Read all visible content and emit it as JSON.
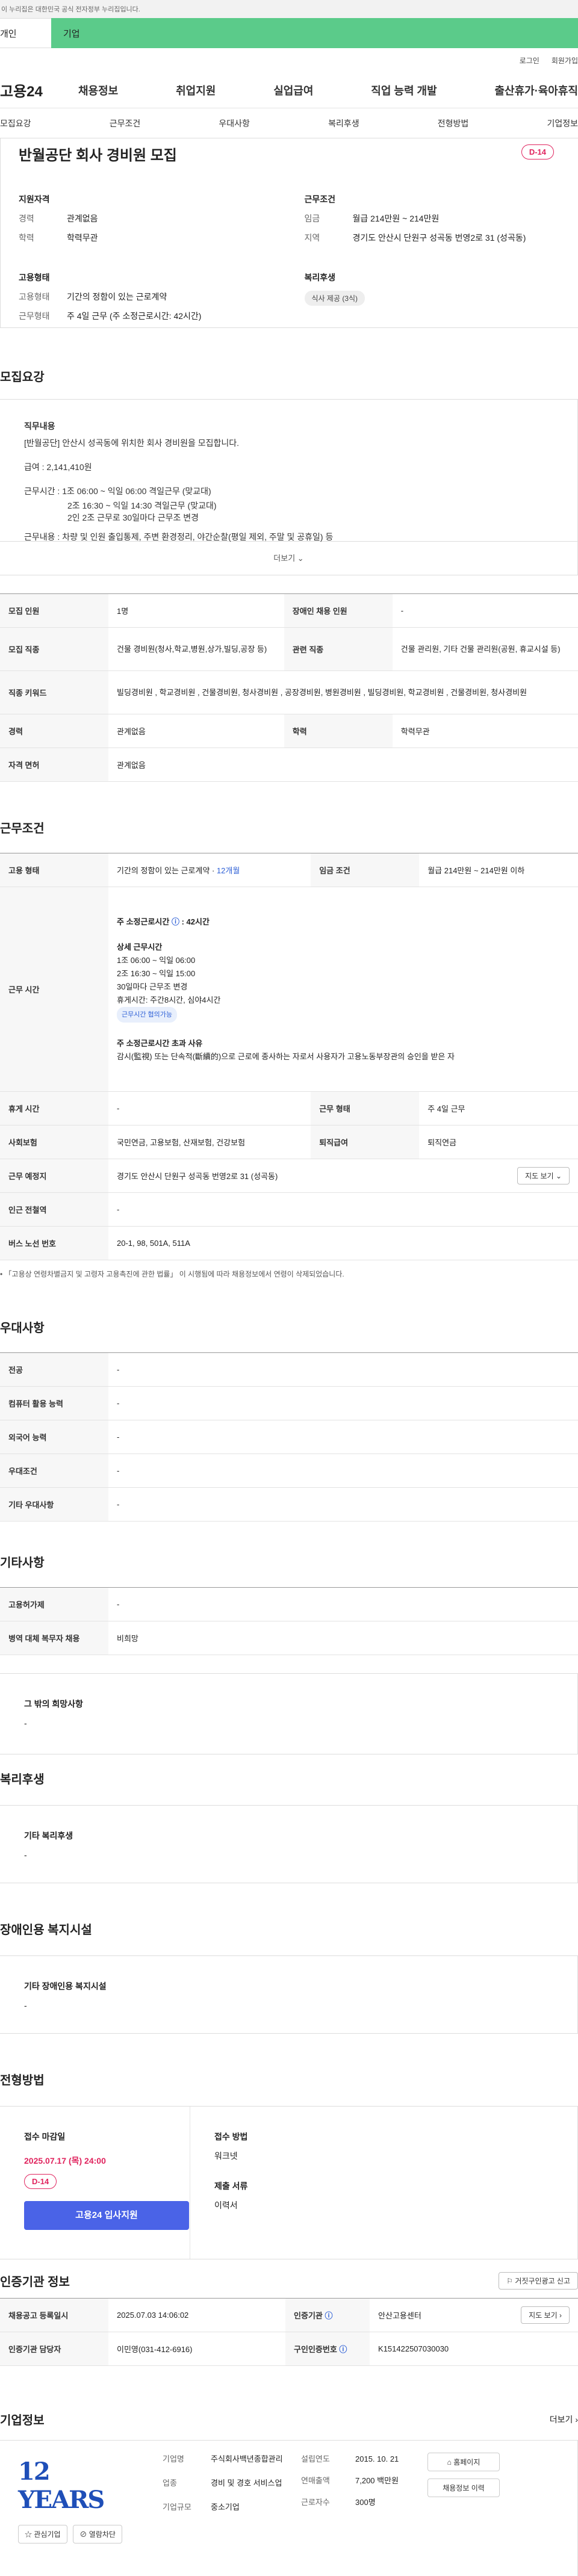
{
  "gov_banner": "이 누리집은 대한민국 공식 전자정부 누리집입니다.",
  "type_tabs": {
    "person": "개인",
    "business": "기업"
  },
  "util_links": [
    "로그인",
    "회원가입"
  ],
  "logo": "고용24",
  "gnb": [
    "채용정보",
    "취업지원",
    "실업급여",
    "직업 능력 개발",
    "출산휴가·육아휴직"
  ],
  "anchor_nav": [
    "모집요강",
    "근무조건",
    "우대사항",
    "복리후생",
    "전형방법",
    "기업정보"
  ],
  "summary": {
    "title": "반월공단 회사 경비원 모집",
    "dday": "D-14",
    "qualification": {
      "heading": "지원자격",
      "rows": [
        {
          "k": "경력",
          "v": "관계없음"
        },
        {
          "k": "학력",
          "v": "학력무관"
        }
      ]
    },
    "conditions": {
      "heading": "근무조건",
      "rows": [
        {
          "k": "임금",
          "v": "월급 214만원 ~ 214만원"
        },
        {
          "k": "지역",
          "v": "경기도 안산시 단원구 성곡동 번영2로 31 (성곡동)"
        }
      ]
    },
    "employment": {
      "heading": "고용형태",
      "rows": [
        {
          "k": "고용형태",
          "v": "기간의 정함이 있는 근로계약"
        },
        {
          "k": "근무형태",
          "v": "주 4일 근무 (주 소정근로시간: 42시간)"
        }
      ]
    },
    "welfare": {
      "heading": "복리후생",
      "pill": "식사 제공 (3식)"
    }
  },
  "recruit": {
    "title": "모집요강",
    "desc_heading": "직무내용",
    "desc_lines": [
      "[반월공단] 안산시 성곡동에 위치한 회사 경비원을 모집합니다.",
      "급여 : 2,141,410원",
      "근무시간 : 1조 06:00 ~ 익일 06:00 격일근무 (맞교대)",
      "2조 16:30 ~ 익일 14:30 격일근무 (맞교대)",
      "2인 2조 근무로 30일마다 근무조 변경",
      "근무내용 : 차량 및 인원 출입통제, 주변 환경정리, 야간순찰(평일 제외, 주말 및 공휴일) 등"
    ],
    "more": "더보기",
    "table": [
      {
        "k1": "모집 인원",
        "v1": "1명",
        "k2": "장애인 채용 인원",
        "v2": "-"
      },
      {
        "k1": "모집 직종",
        "v1": "건물 경비원(청사,학교,병원,상가,빌딩,공장 등)",
        "k2": "관련 직종",
        "v2": "건물 관리원, 기타 건물 관리원(공원, 휴교시설 등)"
      },
      {
        "k1": "직종 키워드",
        "v1": "빌딩경비원 , 학교경비원 , 건물경비원, 청사경비원 , 공장경비원, 병원경비원 , 빌딩경비원, 학교경비원 , 건물경비원, 청사경비원",
        "k2": "",
        "v2": ""
      },
      {
        "k1": "경력",
        "v1": "관계없음",
        "k2": "학력",
        "v2": "학력무관"
      },
      {
        "k1": "자격 면허",
        "v1": "관계없음",
        "k2": "",
        "v2": ""
      }
    ]
  },
  "work": {
    "title": "근무조건",
    "employment_type": "고용 형태",
    "employment_value": "기간의 정함이 있는 근로계약 · ",
    "employment_period": "12개월",
    "wage_label": "임금 조건",
    "wage_value": "월급 214만원 ~ 214만원 이하",
    "hours_label": "근무 시간",
    "hours_title": "주 소정근로시간",
    "hours_value": "42시간",
    "shift_title": "상세 근무시간",
    "shift_lines": [
      "1조 06:00 ~ 익일 06:00",
      " 2조 16:30 ~ 익일 15:00",
      " 30일마다 근무조 변경",
      "휴게시간: 주간8시간, 심야4시간"
    ],
    "shift_tag": "근무시간 협의가능",
    "exceed_title": "주 소정근로시간 초과 사유",
    "exceed_text": "감시(監視) 또는 단속적(斷續的)으로 근로에 종사하는 자로서 사용자가 고용노동부장관의 승인을 받은 자",
    "rows": [
      {
        "k1": "휴게 시간",
        "v1": "-",
        "k2": "근무 형태",
        "v2": "주 4일 근무"
      },
      {
        "k1": "사회보험",
        "v1": "국민연금, 고용보험, 산재보험, 건강보험",
        "k2": "퇴직급여",
        "v2": "퇴직연금"
      }
    ],
    "location_label": "근무 예정지",
    "location_value": "경기도 안산시 단원구 성곡동 번영2로 31 (성곡동)",
    "map_btn": "지도 보기",
    "station_label": "인근 전철역",
    "station_value": "-",
    "bus_label": "버스 노선 번호",
    "bus_value": "20-1, 98, 501A, 511A",
    "notice": "「고용상 연령차별금지 및 고령자 고용촉진에 관한 법률」 이 시행됨에 따라 채용정보에서 연령이 삭제되었습니다."
  },
  "pref": {
    "title": "우대사항",
    "rows": [
      {
        "k": "전공",
        "v": "-"
      },
      {
        "k": "컴퓨터 활용 능력",
        "v": "-"
      },
      {
        "k": "외국어 능력",
        "v": "-"
      },
      {
        "k": "우대조건",
        "v": "-"
      },
      {
        "k": "기타 우대사항",
        "v": "-"
      }
    ]
  },
  "etc": {
    "title": "기타사항",
    "rows": [
      {
        "k": "고용허가제",
        "v": "-"
      },
      {
        "k": "병역 대체 복무자 채용",
        "v": "비희망"
      }
    ],
    "hope_heading": "그 밖의 희망사항",
    "hope_value": "-"
  },
  "welfare": {
    "title": "복리후생",
    "heading": "기타 복리후생",
    "value": "-"
  },
  "disabled": {
    "title": "장애인용 복지시설",
    "heading": "기타 장애인용 복지시설",
    "value": "-"
  },
  "screening": {
    "title": "전형방법",
    "deadline_label": "접수 마감일",
    "deadline_value": "2025.07.17 (목) 24:00",
    "dday": "D-14",
    "apply_btn": "고용24 입사지원",
    "method_label": "접수 방법",
    "method_value": "워크넷",
    "docs_label": "제출 서류",
    "docs_value": "이력서"
  },
  "cert": {
    "title": "인증기관 정보",
    "report_btn": "거짓구인광고 신고",
    "reg_date_label": "채용공고 등록일시",
    "reg_date_value": "2025.07.03 14:06:02",
    "org_label": "인증기관",
    "org_value": "안산고용센터",
    "map_btn": "지도 보기",
    "manager_label": "인증기관 담당자",
    "manager_value": "이민영(031-412-6916)",
    "job_no_label": "구인인증번호",
    "job_no_value": "K151422507030030"
  },
  "company": {
    "title": "기업정보",
    "more": "더보기",
    "logo_text": "12 YEARS",
    "interest_btn": "관심기업",
    "block_btn": "열람차단",
    "fields": [
      {
        "k": "기업명",
        "v": "주식회사백년종합관리"
      },
      {
        "k": "업종",
        "v": "경비 및 경호 서비스업"
      },
      {
        "k": "기업규모",
        "v": "중소기업"
      }
    ],
    "fields2": [
      {
        "k": "설립연도",
        "v": "2015. 10. 21"
      },
      {
        "k": "연매출액",
        "v": "7,200 백만원"
      },
      {
        "k": "근로자수",
        "v": "300명"
      }
    ],
    "homepage_btn": "홈페이지",
    "history_btn": "채용정보 이력"
  },
  "colors": {
    "accent_green": "#5bcb8a",
    "accent_blue": "#4a63e7",
    "dday_red": "#e0245e"
  }
}
